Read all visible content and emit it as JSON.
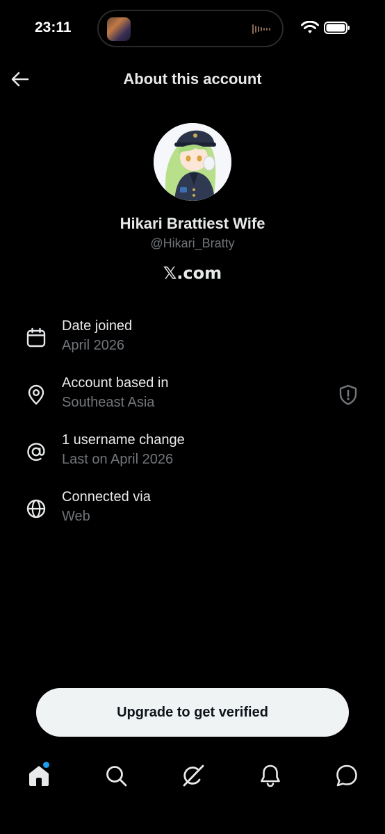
{
  "status_bar": {
    "time": "23:11"
  },
  "header": {
    "title": "About this account",
    "back_icon": "arrow-left-icon"
  },
  "profile": {
    "display_name": "Hikari Brattiest Wife",
    "handle": "@Hikari_Bratty",
    "platform": "𝕏.com"
  },
  "info": [
    {
      "icon": "calendar-icon",
      "label": "Date joined",
      "value": "April 2026"
    },
    {
      "icon": "location-pin-icon",
      "label": "Account based in",
      "value": "Southeast Asia",
      "trailing_icon": "shield-icon"
    },
    {
      "icon": "at-sign-icon",
      "label": "1 username change",
      "value": "Last on April 2026"
    },
    {
      "icon": "globe-icon",
      "label": "Connected via",
      "value": "Web"
    }
  ],
  "upgrade": {
    "label": "Upgrade to get verified"
  },
  "bottom_nav": {
    "items": [
      "home-icon",
      "search-icon",
      "grok-icon",
      "notifications-bell-icon",
      "messages-icon"
    ],
    "active": "home-icon",
    "badge_color": "#1d9bf0"
  },
  "colors": {
    "background": "#000000",
    "primary_text": "#e7e9ea",
    "secondary_text": "#71767b",
    "button_bg": "#eff3f4",
    "button_text": "#0f1419"
  }
}
